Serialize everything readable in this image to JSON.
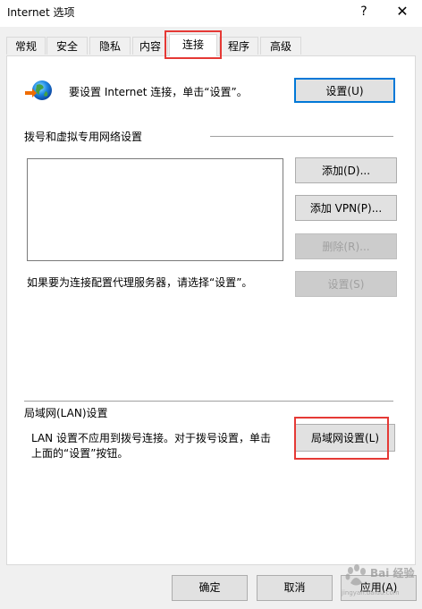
{
  "window": {
    "title": "Internet 选项",
    "help_glyph": "?",
    "close_glyph": "✕"
  },
  "tabs": [
    {
      "label": "常规"
    },
    {
      "label": "安全"
    },
    {
      "label": "隐私"
    },
    {
      "label": "内容"
    },
    {
      "label": "连接",
      "active": true
    },
    {
      "label": "程序"
    },
    {
      "label": "高级"
    }
  ],
  "connection": {
    "setup_text": "要设置 Internet 连接，单击“设置”。",
    "setup_button": "设置(U)",
    "dialup_heading": "拨号和虚拟专用网络设置",
    "add_button": "添加(D)...",
    "add_vpn_button": "添加 VPN(P)...",
    "remove_button": "删除(R)...",
    "proxy_text": "如果要为连接配置代理服务器，请选择“设置”。",
    "settings_button": "设置(S)",
    "lan_heading": "局域网(LAN)设置",
    "lan_text_line1": "LAN 设置不应用到拨号连接。对于拨号设置，单击",
    "lan_text_line2": "上面的“设置”按钮。",
    "lan_button": "局域网设置(L)"
  },
  "footer": {
    "ok_button": "确定",
    "cancel_button": "取消",
    "apply_button": "应用(A)"
  },
  "watermark": {
    "text": "Bai 经验",
    "sub": "jingyan.baidu.com"
  },
  "colors": {
    "highlight": "#e53935",
    "accent": "#0078d7"
  }
}
